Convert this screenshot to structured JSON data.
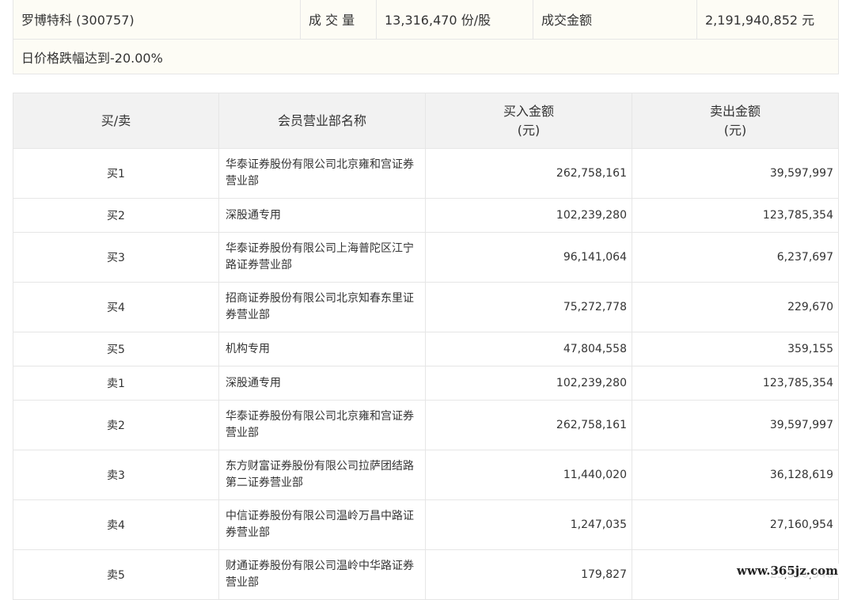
{
  "summary": {
    "stock": "罗博特科 (300757)",
    "volume_label": "成 交 量",
    "volume_value": "13,316,470 份/股",
    "amount_label": "成交金额",
    "amount_value": "2,191,940,852 元",
    "note": "日价格跌幅达到-20.00%"
  },
  "table": {
    "headers": {
      "side": "买/卖",
      "member": "会员营业部名称",
      "buy_line1": "买入金额",
      "buy_line2": "(元)",
      "sell_line1": "卖出金额",
      "sell_line2": "(元)"
    },
    "rows": [
      {
        "side": "买1",
        "name_line1": "华泰证券股份有限公司北京雍和宫证券",
        "name_line2": "营业部",
        "buy": "262,758,161",
        "sell": "39,597,997"
      },
      {
        "side": "买2",
        "name_line1": "深股通专用",
        "name_line2": "",
        "buy": "102,239,280",
        "sell": "123,785,354"
      },
      {
        "side": "买3",
        "name_line1": "华泰证券股份有限公司上海普陀区江宁",
        "name_line2": "路证券营业部",
        "buy": "96,141,064",
        "sell": "6,237,697"
      },
      {
        "side": "买4",
        "name_line1": "招商证券股份有限公司北京知春东里证",
        "name_line2": "券营业部",
        "buy": "75,272,778",
        "sell": "229,670"
      },
      {
        "side": "买5",
        "name_line1": "机构专用",
        "name_line2": "",
        "buy": "47,804,558",
        "sell": "359,155"
      },
      {
        "side": "卖1",
        "name_line1": "深股通专用",
        "name_line2": "",
        "buy": "102,239,280",
        "sell": "123,785,354"
      },
      {
        "side": "卖2",
        "name_line1": "华泰证券股份有限公司北京雍和宫证券",
        "name_line2": "营业部",
        "buy": "262,758,161",
        "sell": "39,597,997"
      },
      {
        "side": "卖3",
        "name_line1": "东方财富证券股份有限公司拉萨团结路",
        "name_line2": "第二证券营业部",
        "buy": "11,440,020",
        "sell": "36,128,619"
      },
      {
        "side": "卖4",
        "name_line1": "中信证券股份有限公司温岭万昌中路证",
        "name_line2": "券营业部",
        "buy": "1,247,035",
        "sell": "27,160,954"
      },
      {
        "side": "卖5",
        "name_line1": "财通证券股份有限公司温岭中华路证券",
        "name_line2": "营业部",
        "buy": "179,827",
        "sell": "25,596,946"
      }
    ]
  },
  "watermark": "www.365jz.com"
}
